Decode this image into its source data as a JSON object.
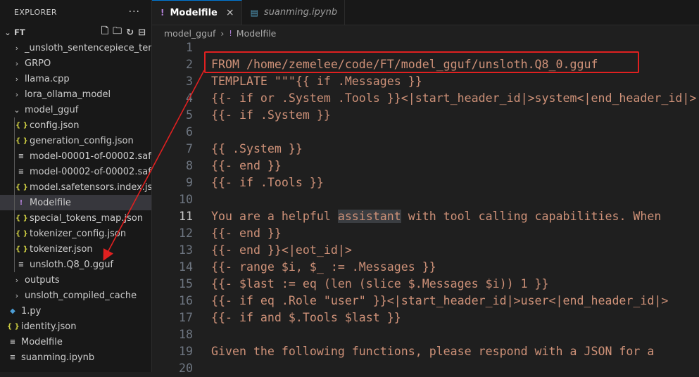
{
  "explorer": {
    "title": "EXPLORER",
    "more_label": "···",
    "root": "FT",
    "items": [
      {
        "label": "_unsloth_sentencepiece_temp",
        "type": "folder"
      },
      {
        "label": "GRPO",
        "type": "folder"
      },
      {
        "label": "llama.cpp",
        "type": "folder"
      },
      {
        "label": "lora_ollama_model",
        "type": "folder"
      },
      {
        "label": "model_gguf",
        "type": "folder-open"
      },
      {
        "label": "config.json",
        "type": "json"
      },
      {
        "label": "generation_config.json",
        "type": "json"
      },
      {
        "label": "model-00001-of-00002.saf...",
        "type": "lines"
      },
      {
        "label": "model-00002-of-00002.saf...",
        "type": "lines"
      },
      {
        "label": "model.safetensors.index.json",
        "type": "json"
      },
      {
        "label": "Modelfile",
        "type": "bang"
      },
      {
        "label": "special_tokens_map.json",
        "type": "json"
      },
      {
        "label": "tokenizer_config.json",
        "type": "json"
      },
      {
        "label": "tokenizer.json",
        "type": "json"
      },
      {
        "label": "unsloth.Q8_0.gguf",
        "type": "lines"
      },
      {
        "label": "outputs",
        "type": "folder"
      },
      {
        "label": "unsloth_compiled_cache",
        "type": "folder"
      },
      {
        "label": "1.py",
        "type": "py"
      },
      {
        "label": "identity.json",
        "type": "json"
      },
      {
        "label": "Modelfile",
        "type": "lines"
      },
      {
        "label": "suanming.ipynb",
        "type": "lines"
      }
    ]
  },
  "tabs": [
    {
      "label": "Modelfile",
      "icon": "!",
      "close": "×"
    },
    {
      "label": "suanming.ipynb",
      "icon": "▤"
    }
  ],
  "breadcrumb": {
    "folder": "model_gguf",
    "sep": "›",
    "file": "Modelfile"
  },
  "editor": {
    "lines": [
      {
        "n": "1",
        "text": ""
      },
      {
        "n": "2",
        "text": "FROM /home/zemelee/code/FT/model_gguf/unsloth.Q8_0.gguf"
      },
      {
        "n": "3",
        "text": "TEMPLATE \"\"\"{{ if .Messages }}"
      },
      {
        "n": "4",
        "text": "{{- if or .System .Tools }}<|start_header_id|>system<|end_header_id|>"
      },
      {
        "n": "5",
        "text": "{{- if .System }}"
      },
      {
        "n": "6",
        "text": ""
      },
      {
        "n": "7",
        "text": "{{ .System }}"
      },
      {
        "n": "8",
        "text": "{{- end }}"
      },
      {
        "n": "9",
        "text": "{{- if .Tools }}"
      },
      {
        "n": "10",
        "text": ""
      },
      {
        "n": "11",
        "pre": "You are a helpful ",
        "hl": "assistant",
        "post": " with tool calling capabilities. When"
      },
      {
        "n": "12",
        "text": "{{- end }}"
      },
      {
        "n": "13",
        "text": "{{- end }}<|eot_id|>"
      },
      {
        "n": "14",
        "text": "{{- range $i, $_ := .Messages }}"
      },
      {
        "n": "15",
        "text": "{{- $last := eq (len (slice $.Messages $i)) 1 }}"
      },
      {
        "n": "16",
        "text": "{{- if eq .Role \"user\" }}<|start_header_id|>user<|end_header_id|>"
      },
      {
        "n": "17",
        "text": "{{- if and $.Tools $last }}"
      },
      {
        "n": "18",
        "text": ""
      },
      {
        "n": "19",
        "text": "Given the following functions, please respond with a JSON for a"
      },
      {
        "n": "20",
        "text": ""
      }
    ]
  },
  "colors": {
    "string": "#ce9178",
    "annotation": "#e02020",
    "accent": "#0078d4"
  }
}
